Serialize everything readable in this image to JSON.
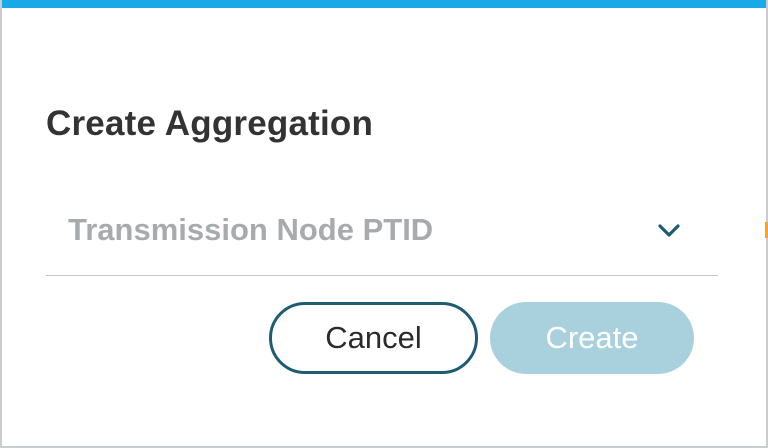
{
  "dialog": {
    "title": "Create Aggregation",
    "select": {
      "placeholder": "Transmission Node PTID",
      "icon": "chevron-down-icon"
    },
    "buttons": {
      "cancel_label": "Cancel",
      "create_label": "Create",
      "create_disabled": true
    }
  },
  "colors": {
    "top_border": "#1aa9e8",
    "title_text": "#333333",
    "placeholder_text": "#a8abae",
    "chevron": "#1d5c73",
    "cancel_border": "#1d5c73",
    "create_disabled_bg": "#a9d1dd"
  }
}
